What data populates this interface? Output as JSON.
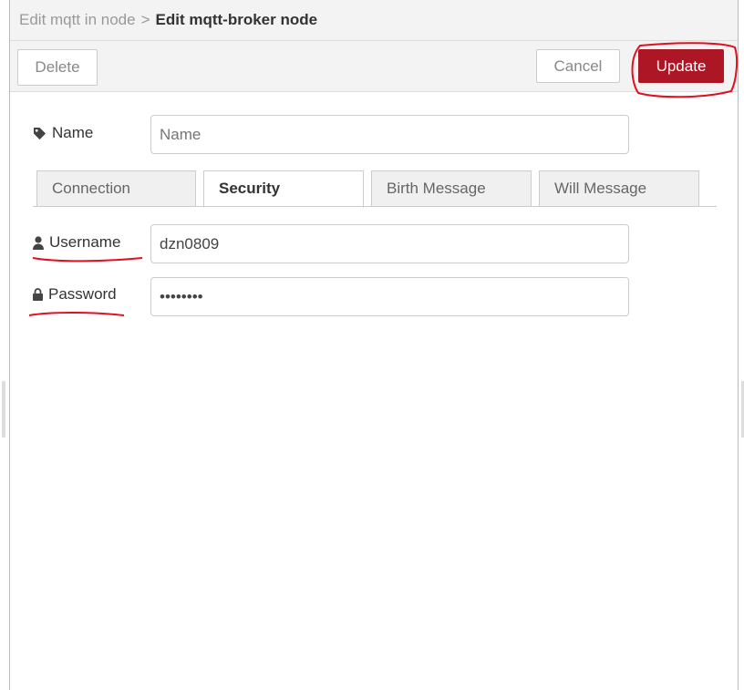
{
  "breadcrumb": {
    "previous": "Edit mqtt in node",
    "separator": ">",
    "current": "Edit mqtt-broker node"
  },
  "toolbar": {
    "delete_label": "Delete",
    "cancel_label": "Cancel",
    "update_label": "Update"
  },
  "form": {
    "name": {
      "label": "Name",
      "placeholder": "Name",
      "value": "",
      "icon": "tag-icon"
    },
    "username": {
      "label": "Username",
      "value": "dzn0809",
      "icon": "user-icon"
    },
    "password": {
      "label": "Password",
      "value": "••••••••",
      "icon": "lock-icon"
    }
  },
  "tabs": [
    {
      "label": "Connection",
      "active": false
    },
    {
      "label": "Security",
      "active": true
    },
    {
      "label": "Birth Message",
      "active": false
    },
    {
      "label": "Will Message",
      "active": false
    }
  ],
  "colors": {
    "accent": "#ad1625",
    "annotation": "#e0101e"
  }
}
